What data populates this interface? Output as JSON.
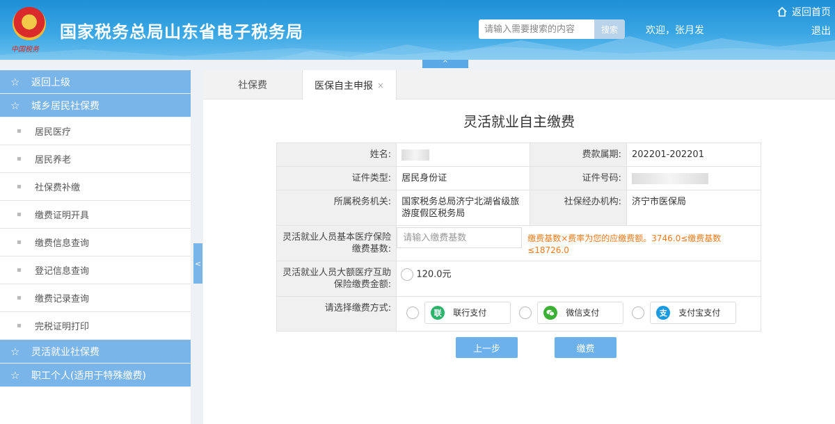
{
  "header": {
    "emblem_text": "中国税务",
    "title": "国家税务总局山东省电子税务局",
    "search_placeholder": "请输入需要搜索的内容",
    "search_button": "搜索",
    "welcome": "欢迎，张月发",
    "home_link": "返回首页",
    "logout": "退出",
    "collapse_glyph": "^"
  },
  "sidebar": {
    "back": "返回上级",
    "section1": "城乡居民社保费",
    "items": [
      "居民医疗",
      "居民养老",
      "社保费补缴",
      "缴费证明开具",
      "缴费信息查询",
      "登记信息查询",
      "缴费记录查询",
      "完税证明打印"
    ],
    "section2": "灵活就业社保费",
    "section3": "职工个人(适用于特殊缴费)",
    "toggle_glyph": "<"
  },
  "tabs": {
    "tab1": "社保费",
    "tab2": "医保自主申报",
    "close_glyph": "×"
  },
  "form": {
    "title": "灵活就业自主缴费",
    "name_label": "姓名:",
    "period_label": "费款属期:",
    "period_value": "202201-202201",
    "idtype_label": "证件类型:",
    "idtype_value": "居民身份证",
    "idno_label": "证件号码:",
    "taxorg_label": "所属税务机关:",
    "taxorg_value": "国家税务总局济宁北湖省级旅游度假区税务局",
    "siorg_label": "社保经办机构:",
    "siorg_value": "济宁市医保局",
    "base_label": "灵活就业人员基本医疗保险缴费基数:",
    "base_placeholder": "请输入缴费基数",
    "base_hint": "缴费基数×费率为您的应缴费额。3746.0≤缴费基数≤18726.0",
    "major_label": "灵活就业人员大额医疗互助保险缴费金额:",
    "major_value": "120.0元",
    "pay_label": "请选择缴费方式:",
    "pay_options": [
      {
        "label": "联行支付",
        "icon": "联",
        "color": "#2db36a"
      },
      {
        "label": "微信支付",
        "icon": "●",
        "color": "#3cb034"
      },
      {
        "label": "支付宝支付",
        "icon": "支",
        "color": "#1a9ae0"
      }
    ]
  },
  "buttons": {
    "prev": "上一步",
    "pay": "缴费"
  }
}
